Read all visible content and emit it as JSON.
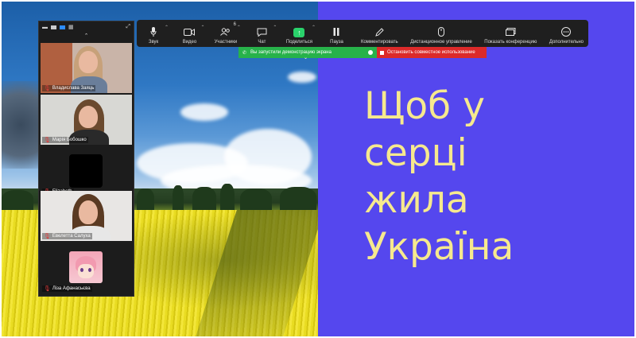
{
  "toolbar": {
    "items": [
      {
        "label": "Звук",
        "icon": "microphone-icon"
      },
      {
        "label": "Видео",
        "icon": "camera-icon"
      },
      {
        "label": "Участники",
        "icon": "participants-icon",
        "count": "6"
      },
      {
        "label": "Чат",
        "icon": "chat-icon"
      },
      {
        "label": "Поделиться",
        "icon": "share-screen-icon"
      },
      {
        "label": "Пауза",
        "icon": "pause-icon"
      },
      {
        "label": "Комментировать",
        "icon": "annotate-icon"
      },
      {
        "label": "Дистанционное управление",
        "icon": "remote-control-icon"
      },
      {
        "label": "Показать конференцию",
        "icon": "show-meeting-icon"
      },
      {
        "label": "Дополнительно",
        "icon": "more-icon"
      }
    ]
  },
  "banners": {
    "sharing": "Вы запустили демонстрацию экрана",
    "stop": "Остановить совместное использование"
  },
  "participants": [
    {
      "name": "Владислава Заяць"
    },
    {
      "name": "Марiя Бобошко"
    },
    {
      "name": "Elizabeth"
    },
    {
      "name": "Евелетта Салуха"
    },
    {
      "name": "Лiза Афанасьєва"
    }
  ],
  "slide": {
    "lines": [
      "Щоб у",
      "серці",
      "жила",
      "Україна"
    ]
  },
  "colors": {
    "slide_bg": "#5547ee",
    "headline": "#f6e98e",
    "share_green": "#27b24a",
    "stop_red": "#dc2a2a",
    "toolbar_bg": "#1f1f1f"
  }
}
